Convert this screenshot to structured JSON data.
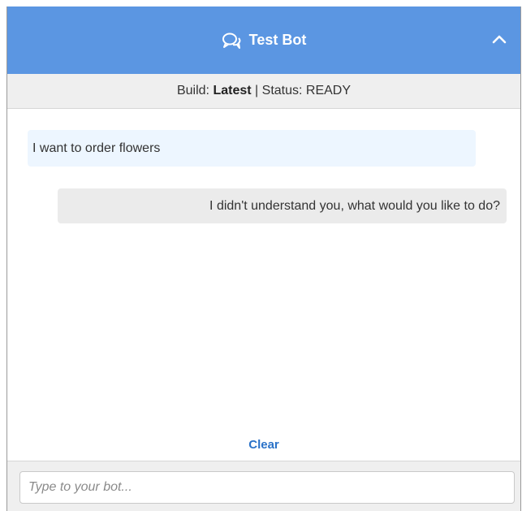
{
  "header": {
    "title": "Test Bot",
    "icon": "chat-bubbles-icon",
    "collapse_icon": "chevron-up-icon",
    "background_color": "#5b96e2"
  },
  "status_bar": {
    "build_label": "Build:",
    "build_value": "Latest",
    "separator": "|",
    "status_label": "Status:",
    "status_value": "READY"
  },
  "messages": [
    {
      "sender": "user",
      "text": "I want to order flowers"
    },
    {
      "sender": "bot",
      "text": "I didn't understand you, what would you like to do?"
    }
  ],
  "clear_label": "Clear",
  "input": {
    "value": "",
    "placeholder": "Type to your bot..."
  }
}
